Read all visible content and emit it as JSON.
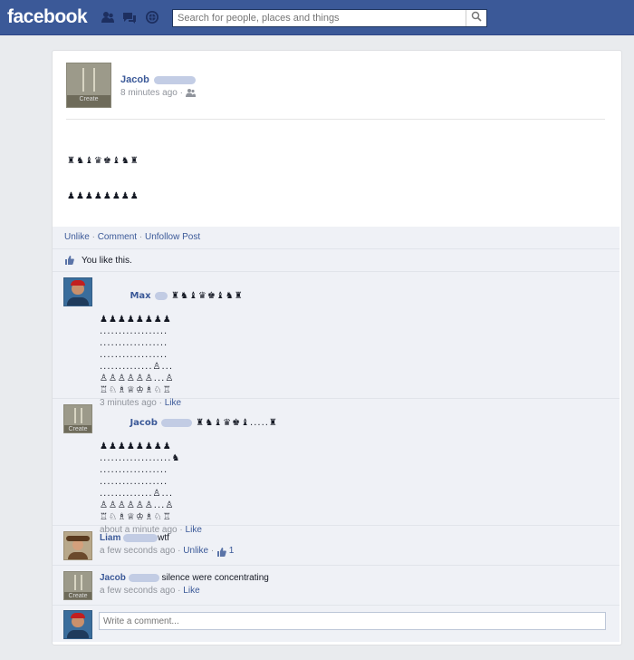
{
  "header": {
    "logo": "facebook",
    "search_placeholder": "Search for people, places and things",
    "icons": [
      "friend-requests-icon",
      "messages-icon",
      "notifications-icon",
      "search-icon"
    ]
  },
  "post": {
    "author": "Jacob",
    "time": "8 minutes ago",
    "audience_icon": "friends-icon",
    "chess_lines": [
      "♜♞♝♛♚♝♞♜",
      "♟♟♟♟♟♟♟♟",
      "",
      "",
      "♙♙♙♙♙♙♙♙",
      "♖♘♗♕♔♗♘♖"
    ],
    "avatar_tag": "Create"
  },
  "actions": {
    "unlike": "Unlike",
    "comment": "Comment",
    "unfollow": "Unfollow Post",
    "sep": "·"
  },
  "likes": {
    "text": "You like this."
  },
  "comments": [
    {
      "author": "Max",
      "first_line": "♜♞♝♛♚♝♞♜",
      "lines": [
        "♟♟♟♟♟♟♟♟",
        "..................",
        "..................",
        "..................",
        "..............♙...",
        "♙♙♙♙♙♙...♙",
        "♖♘♗♕♔♗♘♖"
      ],
      "time": "3 minutes ago",
      "like": "Like",
      "avatar": "person"
    },
    {
      "author": "Jacob",
      "first_line": "♜♞♝♛♚♝.....♜",
      "lines": [
        "♟♟♟♟♟♟♟♟",
        "...................♞",
        "..................",
        "..................",
        "..............♙...",
        "♙♙♙♙♙♙...♙",
        "♖♘♗♕♔♗♘♖"
      ],
      "time": "about a minute ago",
      "like": "Like",
      "avatar": "lamp"
    },
    {
      "author": "Liam",
      "text": "wtf",
      "time": "a few seconds ago",
      "like": "Unlike",
      "like_count": "1",
      "avatar": "cowboy"
    },
    {
      "author": "Jacob",
      "text": "silence were concentrating",
      "time": "a few seconds ago",
      "like": "Like",
      "avatar": "lamp"
    }
  ],
  "composer": {
    "placeholder": "Write a comment..."
  },
  "colors": {
    "brand": "#3b5998",
    "ufi_bg": "#eff1f6",
    "link": "#3b5998"
  }
}
